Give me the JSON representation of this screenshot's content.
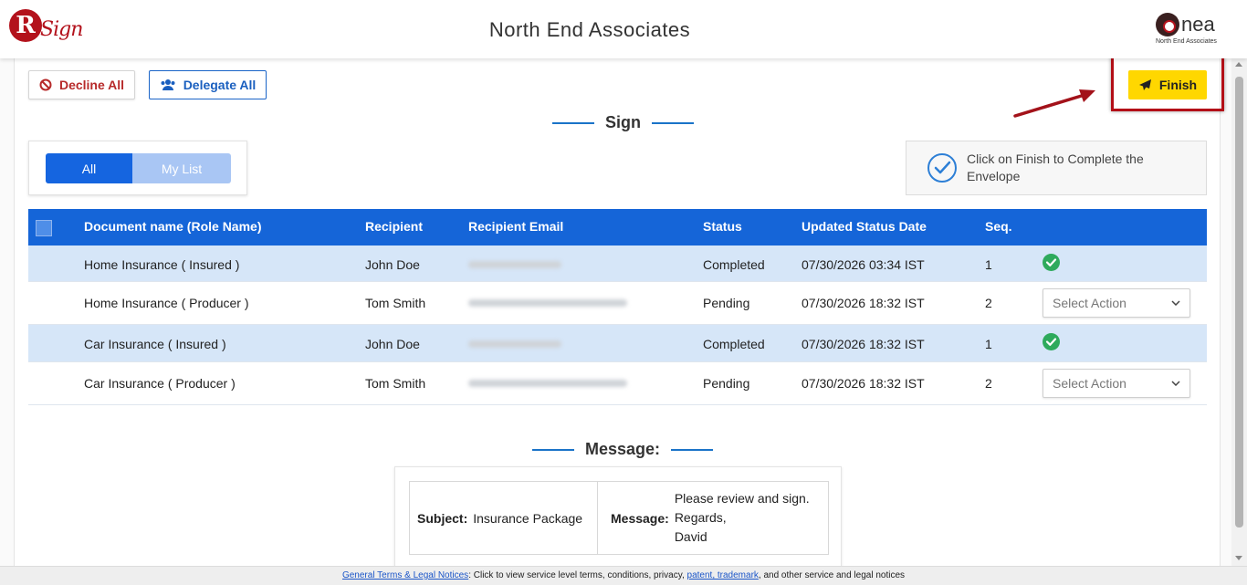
{
  "header": {
    "logo_letter": "R",
    "logo_word": "Sign",
    "company": "North End Associates",
    "brand_name": "nea",
    "brand_sub": "North End Associates"
  },
  "toolbar": {
    "decline_label": "Decline All",
    "delegate_label": "Delegate All",
    "finish_label": "Finish"
  },
  "sign_section": {
    "title": "Sign"
  },
  "filter": {
    "all_label": "All",
    "mylist_label": "My List",
    "selected": "All"
  },
  "info": {
    "text": "Click on Finish to Complete the Envelope"
  },
  "table": {
    "headers": [
      "Document name (Role Name)",
      "Recipient",
      "Recipient Email",
      "Status",
      "Updated Status Date",
      "Seq."
    ],
    "rows": [
      {
        "document": "Home Insurance ( Insured )",
        "recipient": "John Doe",
        "status": "Completed",
        "date": "07/30/2026 03:34 IST",
        "seq": "1",
        "action": "check"
      },
      {
        "document": "Home Insurance ( Producer )",
        "recipient": "Tom Smith",
        "status": "Pending",
        "date": "07/30/2026 18:32 IST",
        "seq": "2",
        "action": "Select Action"
      },
      {
        "document": "Car Insurance ( Insured )",
        "recipient": "John Doe",
        "status": "Completed",
        "date": "07/30/2026 18:32 IST",
        "seq": "1",
        "action": "check"
      },
      {
        "document": "Car Insurance ( Producer )",
        "recipient": "Tom Smith",
        "status": "Pending",
        "date": "07/30/2026 18:32 IST",
        "seq": "2",
        "action": "Select Action"
      }
    ]
  },
  "message_section": {
    "title": "Message:",
    "subject_label": "Subject:",
    "subject": "Insurance Package",
    "message_label": "Message:",
    "message_line1": "Please review and sign.",
    "message_line2": "Regards,",
    "message_line3": "David"
  },
  "footer": {
    "link1": "General Terms & Legal Notices",
    "text1": ": Click to view service level terms, conditions, privacy, ",
    "link2": "patent, trademark",
    "text2": ", and other service and legal notices"
  },
  "colors": {
    "primary": "#1565d8",
    "finish": "#ffd700",
    "highlight": "#b30f17",
    "success": "#2eaa5c"
  }
}
